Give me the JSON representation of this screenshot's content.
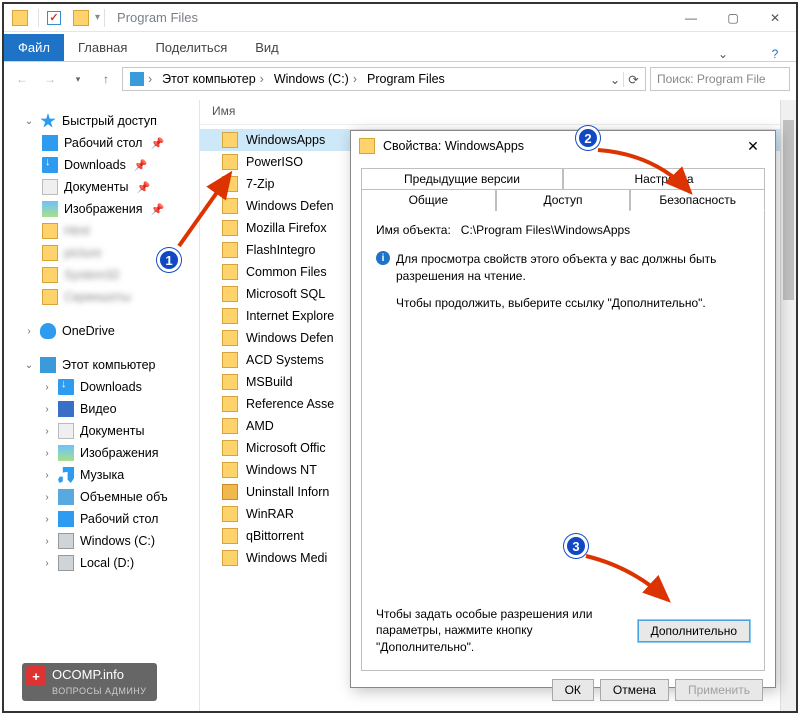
{
  "window": {
    "title": "Program Files",
    "min": "—",
    "max": "▢",
    "close": "✕"
  },
  "ribbon": {
    "file": "Файл",
    "tabs": [
      "Главная",
      "Поделиться",
      "Вид"
    ]
  },
  "address": {
    "segments": [
      "Этот компьютер",
      "Windows (C:)",
      "Program Files"
    ],
    "search_placeholder": "Поиск: Program File"
  },
  "sidebar": {
    "quick": "Быстрый доступ",
    "items_quick": [
      {
        "label": "Рабочий стол",
        "ico": "desk",
        "pin": true
      },
      {
        "label": "Downloads",
        "ico": "dl",
        "pin": true
      },
      {
        "label": "Документы",
        "ico": "doc",
        "pin": true
      },
      {
        "label": "Изображения",
        "ico": "img",
        "pin": true
      }
    ],
    "items_blur": [
      {
        "label": "Html"
      },
      {
        "label": "picture"
      },
      {
        "label": "System32"
      },
      {
        "label": "Скриншоты"
      }
    ],
    "onedrive": "OneDrive",
    "thispc": "Этот компьютер",
    "items_pc": [
      {
        "label": "Downloads",
        "ico": "dl"
      },
      {
        "label": "Видео",
        "ico": "vid"
      },
      {
        "label": "Документы",
        "ico": "doc"
      },
      {
        "label": "Изображения",
        "ico": "img"
      },
      {
        "label": "Музыка",
        "ico": "mus"
      },
      {
        "label": "Объемные объ",
        "ico": "obj"
      },
      {
        "label": "Рабочий стол",
        "ico": "desk"
      },
      {
        "label": "Windows (C:)",
        "ico": "drive"
      },
      {
        "label": "Local (D:)",
        "ico": "drive"
      }
    ]
  },
  "list": {
    "header_name": "Имя",
    "rows": [
      {
        "label": "WindowsApps",
        "sel": true
      },
      {
        "label": "PowerISO"
      },
      {
        "label": "7-Zip"
      },
      {
        "label": "Windows Defen"
      },
      {
        "label": "Mozilla Firefox"
      },
      {
        "label": "FlashIntegro"
      },
      {
        "label": "Common Files"
      },
      {
        "label": "Microsoft SQL"
      },
      {
        "label": "Internet Explore"
      },
      {
        "label": "Windows Defen"
      },
      {
        "label": "ACD Systems"
      },
      {
        "label": "MSBuild"
      },
      {
        "label": "Reference Asse"
      },
      {
        "label": "AMD"
      },
      {
        "label": "Microsoft Offic"
      },
      {
        "label": "Windows NT"
      },
      {
        "label": "Uninstall Inforn",
        "uninst": true
      },
      {
        "label": "WinRAR"
      },
      {
        "label": "qBittorrent"
      },
      {
        "label": "Windows Medi"
      }
    ]
  },
  "dialog": {
    "title": "Свойства: WindowsApps",
    "tabs_top": [
      "Предыдущие версии",
      "Настройка"
    ],
    "tabs_bot": [
      "Общие",
      "Доступ",
      "Безопасность"
    ],
    "obj_label": "Имя объекта:",
    "obj_path": "C:\\Program Files\\WindowsApps",
    "info1": "Для просмотра свойств этого объекта у вас должны быть разрешения на чтение.",
    "info2": "Чтобы продолжить, выберите ссылку \"Дополнительно\".",
    "adv_text": "Чтобы задать особые разрешения или параметры, нажмите кнопку \"Дополнительно\".",
    "adv_btn": "Дополнительно",
    "ok": "ОК",
    "cancel": "Отмена",
    "apply": "Применить"
  },
  "watermark": {
    "brand": "OCOMP.info",
    "sub": "ВОПРОСЫ АДМИНУ"
  }
}
